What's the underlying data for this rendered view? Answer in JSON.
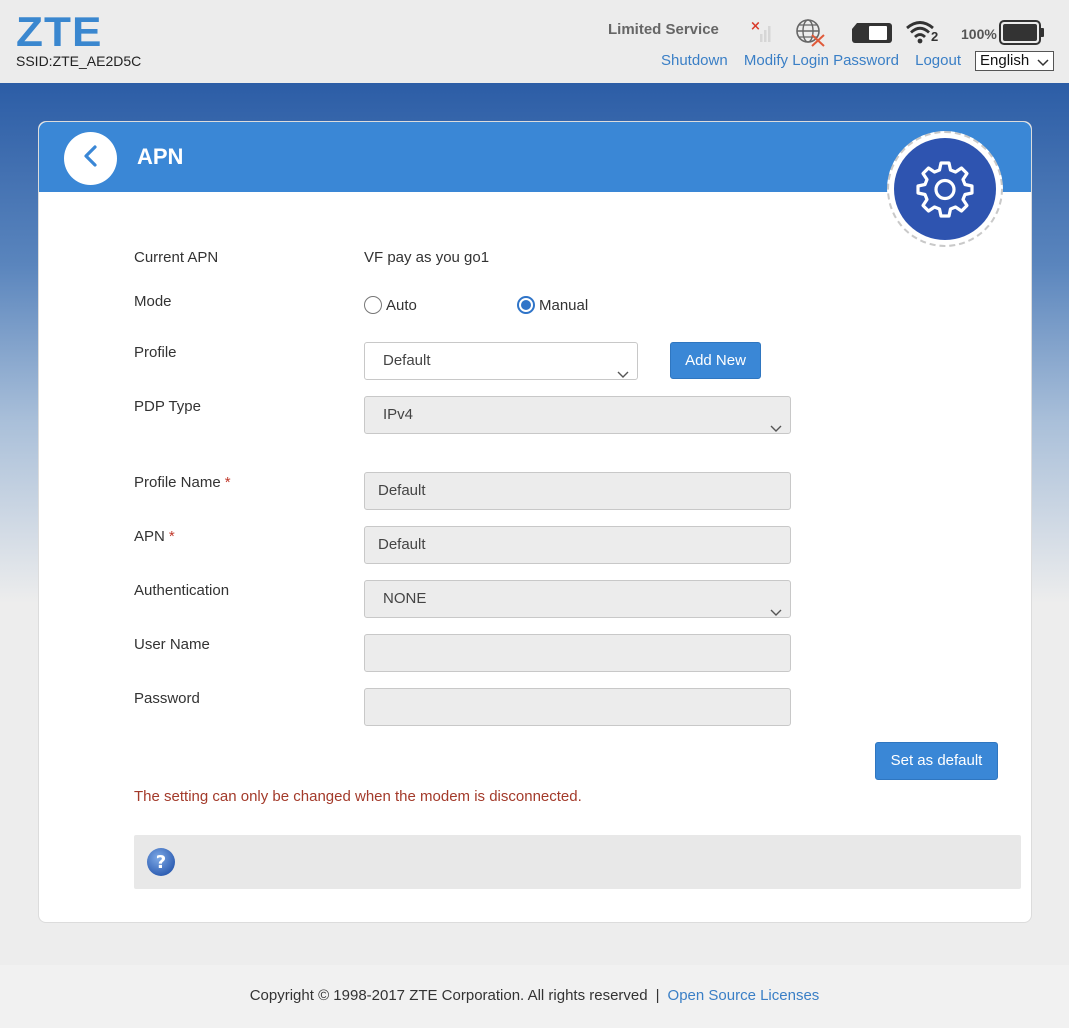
{
  "header": {
    "logo": "ZTE",
    "ssid": "SSID:ZTE_AE2D5C",
    "network_status": "Limited Service",
    "battery_percent": "100%",
    "wifi_clients": "2",
    "links": {
      "shutdown": "Shutdown",
      "modify_password": "Modify Login Password",
      "logout": "Logout"
    },
    "language": "English",
    "icons": [
      "no-signal-icon",
      "no-internet-icon",
      "sim-card-icon",
      "wifi-icon",
      "battery-icon"
    ]
  },
  "card": {
    "title": "APN",
    "icons": [
      "back-arrow-icon",
      "gear-icon"
    ]
  },
  "form": {
    "current_apn": {
      "label": "Current APN",
      "value": "VF pay as you go1"
    },
    "mode": {
      "label": "Mode",
      "options": [
        "Auto",
        "Manual"
      ],
      "selected": "Manual"
    },
    "profile": {
      "label": "Profile",
      "value": "Default",
      "add_button": "Add New"
    },
    "pdp_type": {
      "label": "PDP Type",
      "value": "IPv4"
    },
    "profile_name": {
      "label": "Profile Name",
      "value": "Default",
      "required": "*"
    },
    "apn": {
      "label": "APN",
      "value": "Default",
      "required": "*"
    },
    "authentication": {
      "label": "Authentication",
      "value": "NONE"
    },
    "user_name": {
      "label": "User Name",
      "value": ""
    },
    "password": {
      "label": "Password",
      "value": ""
    },
    "set_default_button": "Set as default",
    "warning": "The setting can only be changed when the modem is disconnected."
  },
  "footer": {
    "copyright": "Copyright © 1998-2017 ZTE Corporation. All rights reserved",
    "separator": "|",
    "licenses_link": "Open Source Licenses"
  },
  "colors": {
    "accent": "#3a87d6",
    "header_bg": "#ececec",
    "warning": "#a33a2a",
    "link": "#3a7fc6"
  }
}
